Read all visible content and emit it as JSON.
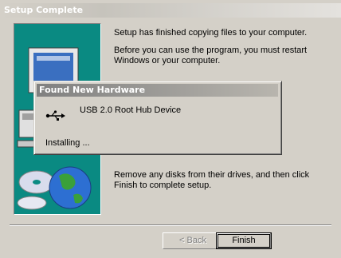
{
  "window": {
    "title": "Setup Complete"
  },
  "main": {
    "para1": "Setup has finished copying files to your computer.",
    "para2": "Before you can use the program, you must restart Windows or your computer.",
    "para3": "Remove any disks from their drives, and then click Finish to complete setup."
  },
  "buttons": {
    "back": "< Back",
    "finish": "Finish"
  },
  "popup": {
    "title": "Found New Hardware",
    "device": "USB 2.0 Root Hub Device",
    "status": "Installing ...",
    "icon": "usb-icon"
  },
  "colors": {
    "panel": "#0a8a82",
    "face": "#d4d0c8"
  },
  "illustration": {
    "icons": [
      "monitor-icon",
      "computer-icon",
      "cd-disc-icon",
      "globe-icon"
    ]
  }
}
